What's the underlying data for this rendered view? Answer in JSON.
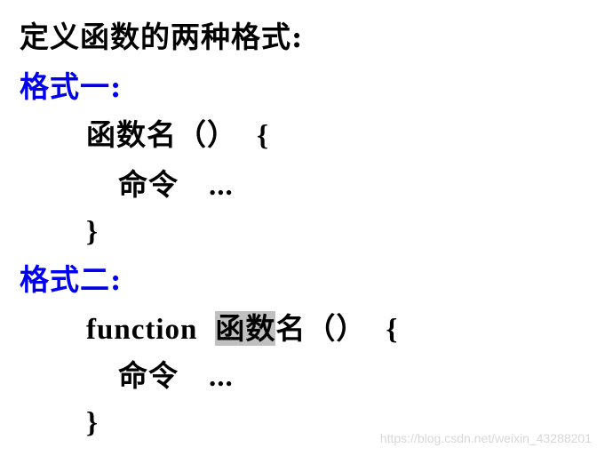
{
  "title": "定义函数的两种格式:",
  "format1": {
    "heading": "格式一:",
    "signature": "函数名（）",
    "open_brace": "{",
    "command": "命令",
    "ellipsis": "...",
    "close_brace": "}"
  },
  "format2": {
    "heading": "格式二:",
    "keyword": "function",
    "name_highlight": "函数",
    "name_rest": "名（）",
    "open_brace": "{",
    "command": "命令",
    "ellipsis": "...",
    "close_brace": "}"
  },
  "watermark": "https://blog.csdn.net/weixin_43288201",
  "colors": {
    "heading": "#0000ee",
    "highlight": "#c0c0c0",
    "text": "#000000"
  }
}
